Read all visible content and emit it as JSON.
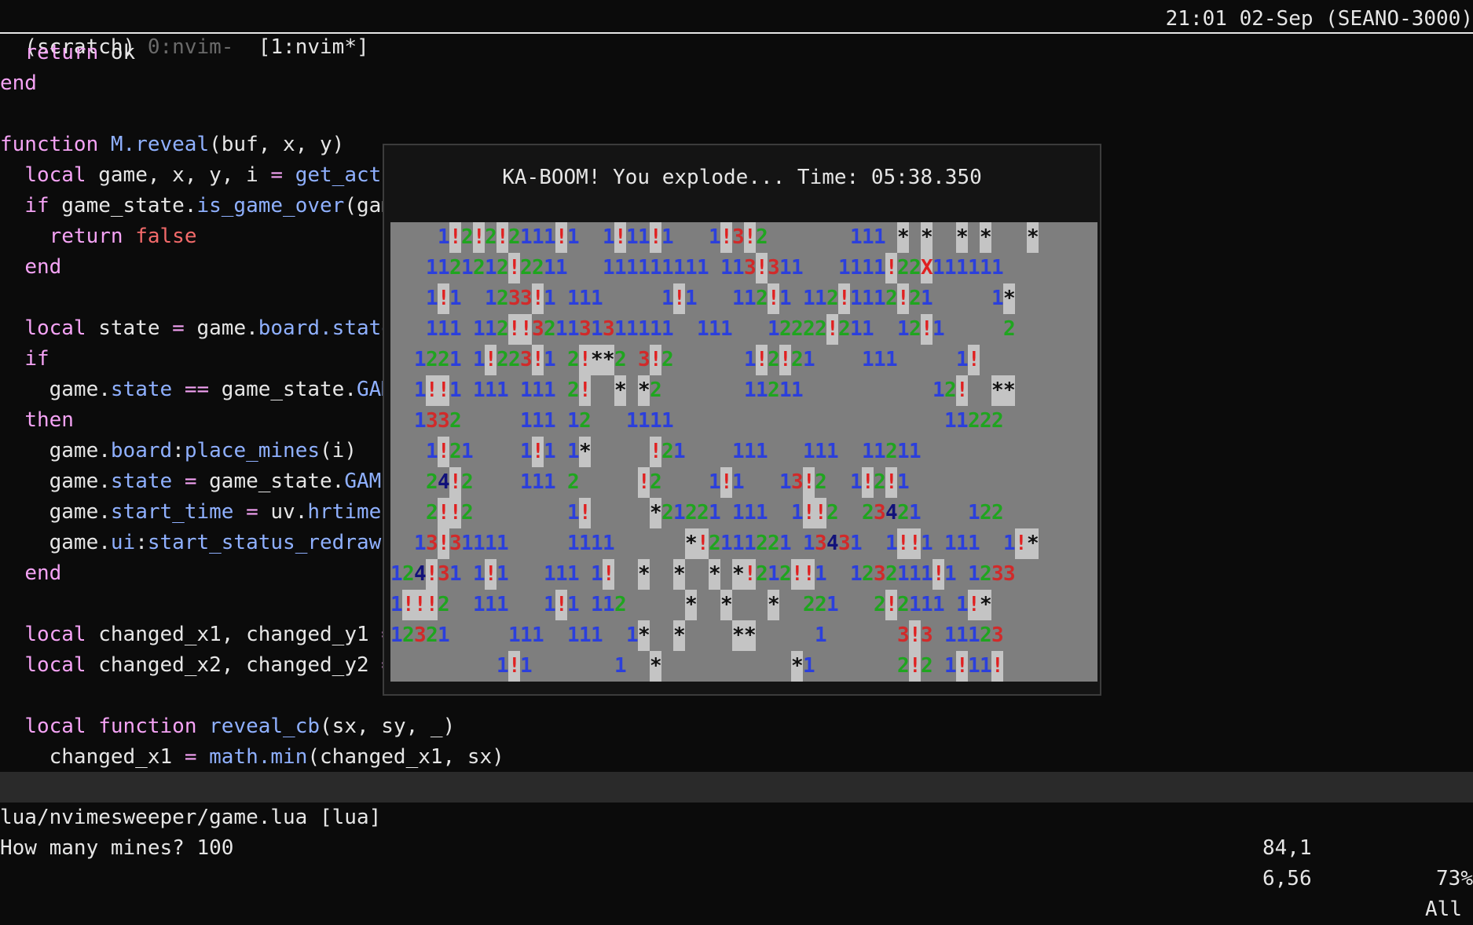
{
  "tmux": {
    "session": "(scratch)",
    "window0": "0:nvim-",
    "window1": "[1:nvim*]",
    "clock": "21:01 02-Sep (SEANO-3000)"
  },
  "editor": {
    "lines": [
      {
        "segments": [
          {
            "t": "  "
          },
          {
            "t": "return",
            "c": "kw"
          },
          {
            "t": " ok"
          }
        ]
      },
      {
        "segments": [
          {
            "t": "end",
            "c": "kw"
          }
        ]
      },
      {
        "segments": [
          {
            "t": ""
          }
        ]
      },
      {
        "segments": [
          {
            "t": "function",
            "c": "kw"
          },
          {
            "t": " "
          },
          {
            "t": "M.reveal",
            "c": "fn"
          },
          {
            "t": "(buf, x, y)"
          }
        ]
      },
      {
        "segments": [
          {
            "t": "  "
          },
          {
            "t": "local",
            "c": "kw"
          },
          {
            "t": " game, x, y, i "
          },
          {
            "t": "=",
            "c": "kw"
          },
          {
            "t": " "
          },
          {
            "t": "get_acti",
            "c": "fn"
          }
        ]
      },
      {
        "segments": [
          {
            "t": "  "
          },
          {
            "t": "if",
            "c": "kw"
          },
          {
            "t": " game_state."
          },
          {
            "t": "is_game_over",
            "c": "fn"
          },
          {
            "t": "(gam"
          }
        ]
      },
      {
        "segments": [
          {
            "t": "    "
          },
          {
            "t": "return",
            "c": "kw"
          },
          {
            "t": " "
          },
          {
            "t": "false",
            "c": "kw2"
          }
        ]
      },
      {
        "segments": [
          {
            "t": "  "
          },
          {
            "t": "end",
            "c": "kw"
          }
        ]
      },
      {
        "segments": [
          {
            "t": ""
          }
        ]
      },
      {
        "segments": [
          {
            "t": "  "
          },
          {
            "t": "local",
            "c": "kw"
          },
          {
            "t": " state "
          },
          {
            "t": "=",
            "c": "kw"
          },
          {
            "t": " game."
          },
          {
            "t": "board.state",
            "c": "fn"
          }
        ]
      },
      {
        "segments": [
          {
            "t": "  "
          },
          {
            "t": "if",
            "c": "kw"
          }
        ]
      },
      {
        "segments": [
          {
            "t": "    game."
          },
          {
            "t": "state",
            "c": "fn"
          },
          {
            "t": " "
          },
          {
            "t": "==",
            "c": "kw"
          },
          {
            "t": " game_state."
          },
          {
            "t": "GAM",
            "c": "fn"
          }
        ]
      },
      {
        "segments": [
          {
            "t": "  "
          },
          {
            "t": "then",
            "c": "kw"
          }
        ]
      },
      {
        "segments": [
          {
            "t": "    game."
          },
          {
            "t": "board",
            "c": "fn"
          },
          {
            "t": ":"
          },
          {
            "t": "place_mines",
            "c": "fn"
          },
          {
            "t": "(i)"
          }
        ]
      },
      {
        "segments": [
          {
            "t": "    game."
          },
          {
            "t": "state",
            "c": "fn"
          },
          {
            "t": " "
          },
          {
            "t": "=",
            "c": "kw"
          },
          {
            "t": " game_state."
          },
          {
            "t": "GAME",
            "c": "fn"
          }
        ]
      },
      {
        "segments": [
          {
            "t": "    game."
          },
          {
            "t": "start_time",
            "c": "fn"
          },
          {
            "t": " "
          },
          {
            "t": "=",
            "c": "kw"
          },
          {
            "t": " uv."
          },
          {
            "t": "hrtime",
            "c": "fn"
          },
          {
            "t": "("
          }
        ]
      },
      {
        "segments": [
          {
            "t": "    game."
          },
          {
            "t": "ui",
            "c": "fn"
          },
          {
            "t": ":"
          },
          {
            "t": "start_status_redraw",
            "c": "fn"
          },
          {
            "t": "("
          }
        ]
      },
      {
        "segments": [
          {
            "t": "  "
          },
          {
            "t": "end",
            "c": "kw"
          }
        ]
      },
      {
        "segments": [
          {
            "t": ""
          }
        ]
      },
      {
        "segments": [
          {
            "t": "  "
          },
          {
            "t": "local",
            "c": "kw"
          },
          {
            "t": " changed_x1, changed_y1 "
          },
          {
            "t": "=",
            "c": "kw"
          }
        ]
      },
      {
        "segments": [
          {
            "t": "  "
          },
          {
            "t": "local",
            "c": "kw"
          },
          {
            "t": " changed_x2, changed_y2 "
          },
          {
            "t": "=",
            "c": "kw"
          }
        ]
      },
      {
        "segments": [
          {
            "t": ""
          }
        ]
      },
      {
        "segments": [
          {
            "t": "  "
          },
          {
            "t": "local",
            "c": "kw"
          },
          {
            "t": " "
          },
          {
            "t": "function",
            "c": "kw"
          },
          {
            "t": " "
          },
          {
            "t": "reveal_cb",
            "c": "fn"
          },
          {
            "t": "(sx, sy, _)"
          }
        ]
      },
      {
        "segments": [
          {
            "t": "    changed_x1 "
          },
          {
            "t": "=",
            "c": "kw"
          },
          {
            "t": " "
          },
          {
            "t": "math.min",
            "c": "fn"
          },
          {
            "t": "(changed_x1, sx)"
          }
        ]
      }
    ]
  },
  "popup": {
    "title": "KA-BOOM! You explode... Time: 05:38.350",
    "board": {
      "rows": [
        "    1!2!2!2111!1  1!11!1   1!3!2       111 * *  * *   *",
        "   1121212!2211   111111111 113!311   1111!22X111111  ",
        "   1!1  1233!1 111     1!1   112!1 112!1112!21     1*  ",
        "   111 112!!321131311111  111   12222!211  12!1     2  ",
        "  1221 1!223!1 2!**2 3!2      1!2!21    111     1!  ",
        "  1!!1 111 111 2!  * *2       11211           12!  **",
        "  1332     111 12   1111                       11222",
        "   1!21    1!1 1*     !21    111   111  11211       ",
        "   24!2    111 2     !2    1!1   13!2  1!2!1       ",
        "   2!!2        1!     *21221 111  1!!2  23421    122",
        "  13!31111     1111      *!2111221 13431  1!!1 111  1!*",
        "124!31 1!1   111 1!  *  *  * *!212!!1  1232111!1 1233",
        "1!!!2  111   1!1 112     *  *   *  221   2!2111 1!*  ",
        "12321     111  111  1*  *    **     1      3!3 11123  ",
        "         1!1       1  *           *1       2!2 1!11!   "
      ],
      "revealed_mask": [
        "0000000000000000000000000000000000000000000000000000000000",
        "0000000000000000000000000000000000000000000000000000000000",
        "0000000000000000000000000000000000000000000000000000000000",
        "0000000000000000000000000000000000000000000000000000000000",
        "0000000000000000000000000000000000000000000000000000000000",
        "0000000000000000000000000000000000000000000000000000000000",
        "0000000000000000000000000000000000000000000000000000000000",
        "0000000000000000000000000000000000000000000000000000000000",
        "0000000000000000000000000000000000000000000000000000000000",
        "0000000000000000000000000000000000000000000000000000000000",
        "0000000000000000000000000000000000000000000000000000000000",
        "0000000000000000000000000000000000000000000000000000000000",
        "0000000000000000000000000000000000000000000000000000000000",
        "0000000000000000000000000000000000000000000000000000000000",
        "0000000000000000000000000000000000000000000000000000000000"
      ],
      "colors": {
        "1": "#2b3fdc",
        "2": "#1fa51f",
        "3": "#d12a2a",
        "4": "#12127a",
        "!": "#e02020",
        "*": "#101010",
        "X": "#e02020",
        "hidden_bg": "#7e7e7e",
        "open_bg": "#c4c4c4",
        "exploded_bg": "#e00000"
      }
    }
  },
  "statusline": {
    "file": "lua/nvimesweeper/game.lua [lua]",
    "position": "84,1",
    "percent": "73%"
  },
  "cmdline": {
    "text": "How many mines? 100",
    "position": "6,56",
    "scroll": "All"
  }
}
